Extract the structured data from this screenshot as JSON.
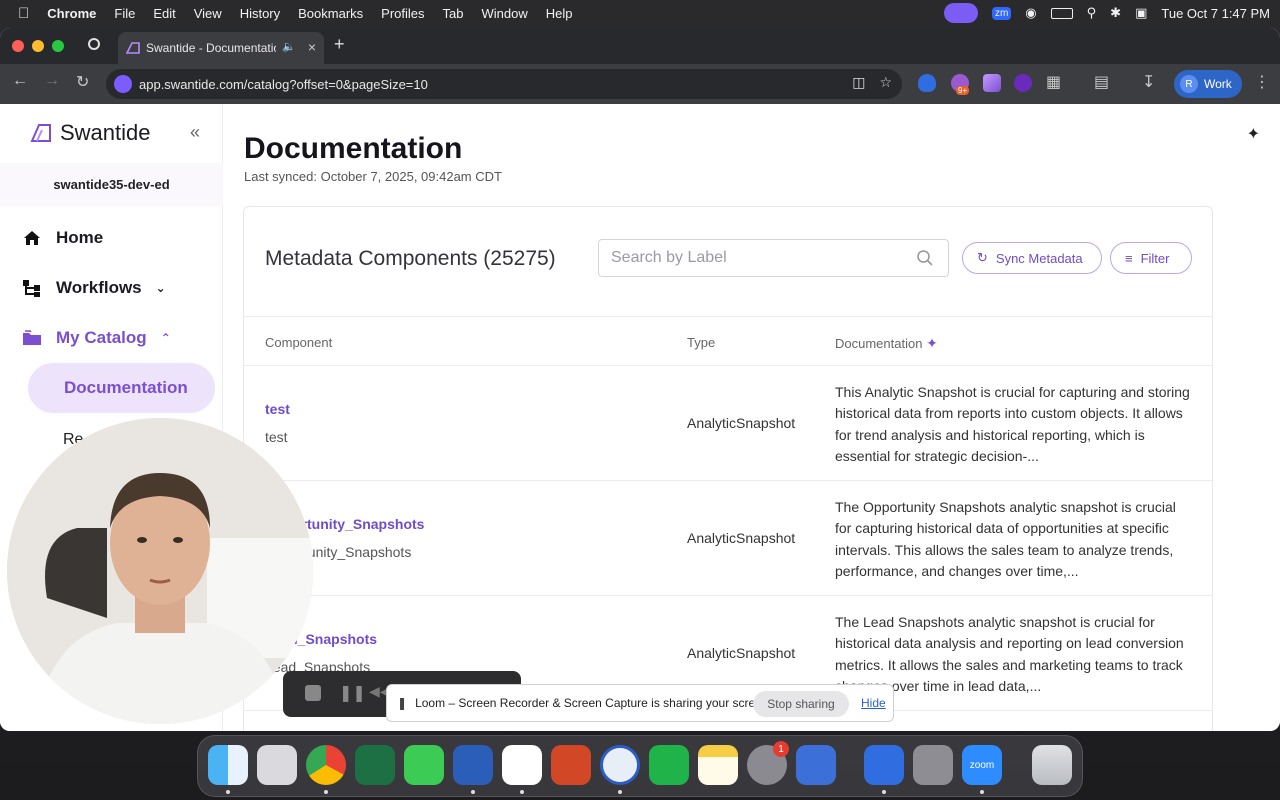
{
  "menubar": {
    "app": "Chrome",
    "items": [
      "File",
      "Edit",
      "View",
      "History",
      "Bookmarks",
      "Profiles",
      "Tab",
      "Window",
      "Help"
    ],
    "datetime": "Tue Oct 7  1:47 PM",
    "zoom_badge": "zm"
  },
  "browser": {
    "tab_title": "Swantide - Documentation",
    "url": "app.swantide.com/catalog?offset=0&pageSize=10",
    "profile_initial": "R",
    "profile_label": "Work",
    "ext_badge": "9+"
  },
  "sidebar": {
    "brand": "Swantide",
    "org": "swantide35-dev-ed",
    "items": [
      {
        "label": "Home"
      },
      {
        "label": "Workflows"
      },
      {
        "label": "My Catalog"
      }
    ],
    "subitem_active": "Documentation",
    "subitem_partial": "Re"
  },
  "main": {
    "title": "Documentation",
    "synced": "Last synced: October 7, 2025, 09:42am CDT",
    "card_title": "Metadata Components (25275)",
    "search_placeholder": "Search by Label",
    "sync_button": "Sync Metadata",
    "filter_button": "Filter",
    "columns": [
      "Component",
      "Type",
      "Documentation"
    ],
    "rows": [
      {
        "label": "test",
        "api_name": "test",
        "type": "AnalyticSnapshot",
        "doc": "This Analytic Snapshot is crucial for capturing and storing historical data from reports into custom objects. It allows for trend analysis and historical reporting, which is essential for strategic decision-..."
      },
      {
        "label": "Opportunity_Snapshots",
        "api_name": "Opportunity_Snapshots",
        "type": "AnalyticSnapshot",
        "doc": "The Opportunity Snapshots analytic snapshot is crucial for capturing historical data of opportunities at specific intervals. This allows the sales team to analyze trends, performance, and changes over time,..."
      },
      {
        "label": "Lead_Snapshots",
        "api_name": "Lead_Snapshots",
        "type": "AnalyticSnapshot",
        "doc": "The Lead Snapshots analytic snapshot is crucial for historical data analysis and reporting on lead conversion metrics. It allows the sales and marketing teams to track changes over time in lead data,..."
      }
    ]
  },
  "loom": {
    "message": "Loom – Screen Recorder & Screen Capture is sharing your screen.",
    "stop": "Stop sharing",
    "hide": "Hide"
  },
  "dock": {
    "settings_badge": "1",
    "zoom_label": "zoom"
  }
}
